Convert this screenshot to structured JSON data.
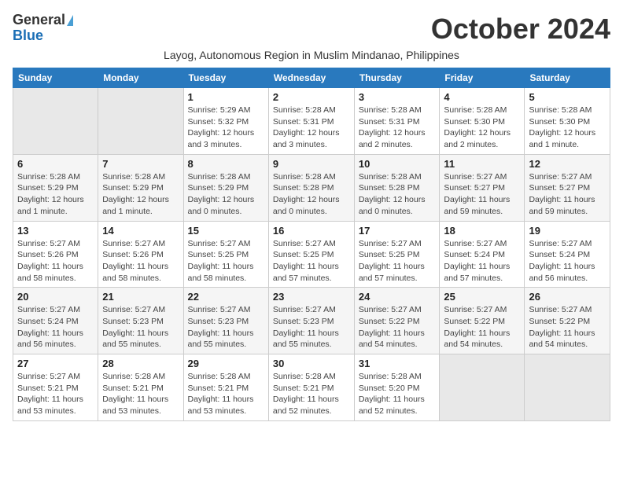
{
  "header": {
    "logo_line1": "General",
    "logo_line2": "Blue",
    "month": "October 2024",
    "subtitle": "Layog, Autonomous Region in Muslim Mindanao, Philippines"
  },
  "weekdays": [
    "Sunday",
    "Monday",
    "Tuesday",
    "Wednesday",
    "Thursday",
    "Friday",
    "Saturday"
  ],
  "weeks": [
    [
      {
        "day": "",
        "info": ""
      },
      {
        "day": "",
        "info": ""
      },
      {
        "day": "1",
        "info": "Sunrise: 5:29 AM\nSunset: 5:32 PM\nDaylight: 12 hours and 3 minutes."
      },
      {
        "day": "2",
        "info": "Sunrise: 5:28 AM\nSunset: 5:31 PM\nDaylight: 12 hours and 3 minutes."
      },
      {
        "day": "3",
        "info": "Sunrise: 5:28 AM\nSunset: 5:31 PM\nDaylight: 12 hours and 2 minutes."
      },
      {
        "day": "4",
        "info": "Sunrise: 5:28 AM\nSunset: 5:30 PM\nDaylight: 12 hours and 2 minutes."
      },
      {
        "day": "5",
        "info": "Sunrise: 5:28 AM\nSunset: 5:30 PM\nDaylight: 12 hours and 1 minute."
      }
    ],
    [
      {
        "day": "6",
        "info": "Sunrise: 5:28 AM\nSunset: 5:29 PM\nDaylight: 12 hours and 1 minute."
      },
      {
        "day": "7",
        "info": "Sunrise: 5:28 AM\nSunset: 5:29 PM\nDaylight: 12 hours and 1 minute."
      },
      {
        "day": "8",
        "info": "Sunrise: 5:28 AM\nSunset: 5:29 PM\nDaylight: 12 hours and 0 minutes."
      },
      {
        "day": "9",
        "info": "Sunrise: 5:28 AM\nSunset: 5:28 PM\nDaylight: 12 hours and 0 minutes."
      },
      {
        "day": "10",
        "info": "Sunrise: 5:28 AM\nSunset: 5:28 PM\nDaylight: 12 hours and 0 minutes."
      },
      {
        "day": "11",
        "info": "Sunrise: 5:27 AM\nSunset: 5:27 PM\nDaylight: 11 hours and 59 minutes."
      },
      {
        "day": "12",
        "info": "Sunrise: 5:27 AM\nSunset: 5:27 PM\nDaylight: 11 hours and 59 minutes."
      }
    ],
    [
      {
        "day": "13",
        "info": "Sunrise: 5:27 AM\nSunset: 5:26 PM\nDaylight: 11 hours and 58 minutes."
      },
      {
        "day": "14",
        "info": "Sunrise: 5:27 AM\nSunset: 5:26 PM\nDaylight: 11 hours and 58 minutes."
      },
      {
        "day": "15",
        "info": "Sunrise: 5:27 AM\nSunset: 5:25 PM\nDaylight: 11 hours and 58 minutes."
      },
      {
        "day": "16",
        "info": "Sunrise: 5:27 AM\nSunset: 5:25 PM\nDaylight: 11 hours and 57 minutes."
      },
      {
        "day": "17",
        "info": "Sunrise: 5:27 AM\nSunset: 5:25 PM\nDaylight: 11 hours and 57 minutes."
      },
      {
        "day": "18",
        "info": "Sunrise: 5:27 AM\nSunset: 5:24 PM\nDaylight: 11 hours and 57 minutes."
      },
      {
        "day": "19",
        "info": "Sunrise: 5:27 AM\nSunset: 5:24 PM\nDaylight: 11 hours and 56 minutes."
      }
    ],
    [
      {
        "day": "20",
        "info": "Sunrise: 5:27 AM\nSunset: 5:24 PM\nDaylight: 11 hours and 56 minutes."
      },
      {
        "day": "21",
        "info": "Sunrise: 5:27 AM\nSunset: 5:23 PM\nDaylight: 11 hours and 55 minutes."
      },
      {
        "day": "22",
        "info": "Sunrise: 5:27 AM\nSunset: 5:23 PM\nDaylight: 11 hours and 55 minutes."
      },
      {
        "day": "23",
        "info": "Sunrise: 5:27 AM\nSunset: 5:23 PM\nDaylight: 11 hours and 55 minutes."
      },
      {
        "day": "24",
        "info": "Sunrise: 5:27 AM\nSunset: 5:22 PM\nDaylight: 11 hours and 54 minutes."
      },
      {
        "day": "25",
        "info": "Sunrise: 5:27 AM\nSunset: 5:22 PM\nDaylight: 11 hours and 54 minutes."
      },
      {
        "day": "26",
        "info": "Sunrise: 5:27 AM\nSunset: 5:22 PM\nDaylight: 11 hours and 54 minutes."
      }
    ],
    [
      {
        "day": "27",
        "info": "Sunrise: 5:27 AM\nSunset: 5:21 PM\nDaylight: 11 hours and 53 minutes."
      },
      {
        "day": "28",
        "info": "Sunrise: 5:28 AM\nSunset: 5:21 PM\nDaylight: 11 hours and 53 minutes."
      },
      {
        "day": "29",
        "info": "Sunrise: 5:28 AM\nSunset: 5:21 PM\nDaylight: 11 hours and 53 minutes."
      },
      {
        "day": "30",
        "info": "Sunrise: 5:28 AM\nSunset: 5:21 PM\nDaylight: 11 hours and 52 minutes."
      },
      {
        "day": "31",
        "info": "Sunrise: 5:28 AM\nSunset: 5:20 PM\nDaylight: 11 hours and 52 minutes."
      },
      {
        "day": "",
        "info": ""
      },
      {
        "day": "",
        "info": ""
      }
    ]
  ]
}
